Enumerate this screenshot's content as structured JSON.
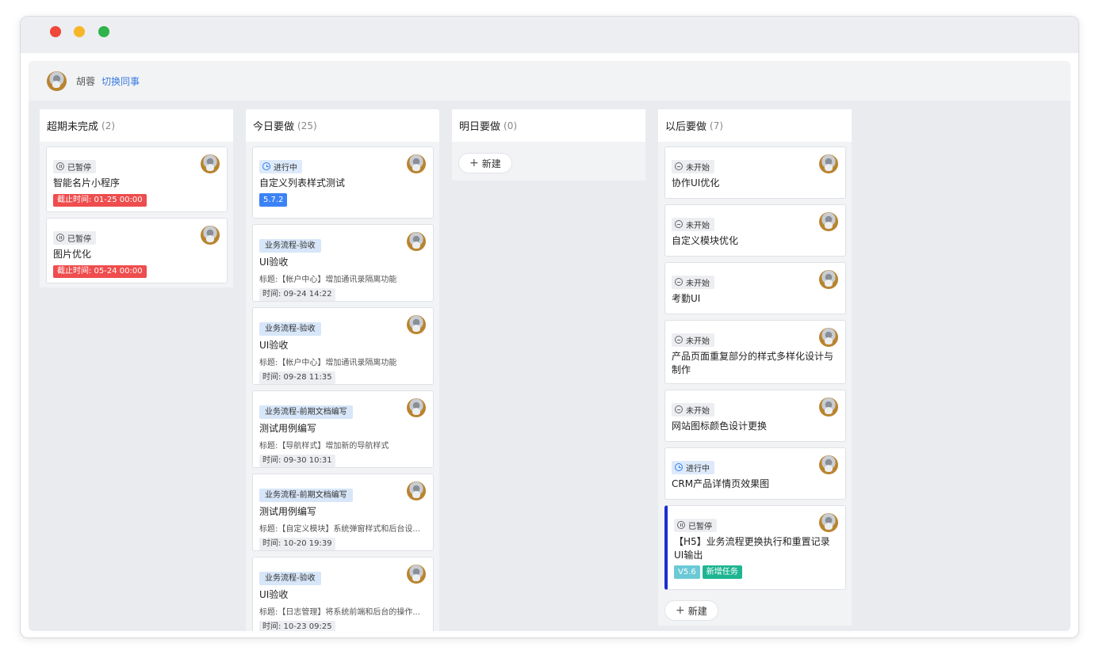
{
  "user": {
    "name": "胡蓉",
    "switch_label": "切换同事"
  },
  "columns": [
    {
      "title": "超期未完成",
      "count": "(2)",
      "cards": [
        {
          "status": "已暂停",
          "title": "智能名片小程序",
          "deadline": "截止时间: 01-25 00:00"
        },
        {
          "status": "已暂停",
          "title": "图片优化",
          "deadline": "截止时间: 05-24 00:00"
        }
      ]
    },
    {
      "title": "今日要做",
      "count": "(25)",
      "cards": [
        {
          "status": "进行中",
          "title": "自定义列表样式测试",
          "version": "5.7.2"
        },
        {
          "tag": "业务流程-验收",
          "title": "UI验收",
          "sub": "标题:【帐户中心】增加通讯录隔离功能",
          "time": "时间: 09-24 14:22"
        },
        {
          "tag": "业务流程-验收",
          "title": "UI验收",
          "sub": "标题:【帐户中心】增加通讯录隔离功能",
          "time": "时间: 09-28 11:35"
        },
        {
          "tag": "业务流程-前期文档编写",
          "title": "测试用例编写",
          "sub": "标题:【导航样式】增加新的导航样式",
          "time": "时间: 09-30 10:31"
        },
        {
          "tag": "业务流程-前期文档编写",
          "title": "测试用例编写",
          "sub": "标题:【自定义模块】系统弹窗样式和后台设...",
          "time": "时间: 10-20 19:39"
        },
        {
          "tag": "业务流程-验收",
          "title": "UI验收",
          "sub": "标题:【日志管理】将系统前端和后台的操作...",
          "time": "时间: 10-23 09:25"
        }
      ]
    },
    {
      "title": "明日要做",
      "count": "(0)",
      "new_label": "新建"
    },
    {
      "title": "以后要做",
      "count": "(7)",
      "cards": [
        {
          "status": "未开始",
          "title": "协作UI优化"
        },
        {
          "status": "未开始",
          "title": "自定义模块优化"
        },
        {
          "status": "未开始",
          "title": "考勤UI"
        },
        {
          "status": "未开始",
          "title": "产品页面重复部分的样式多样化设计与制作"
        },
        {
          "status": "未开始",
          "title": "网站图标颜色设计更换"
        },
        {
          "status": "进行中",
          "title": "CRM产品详情页效果图"
        },
        {
          "status": "已暂停",
          "title": "【H5】业务流程更换执行和重置记录 UI输出",
          "version": "V5.6",
          "extra_tag": "新增任务"
        }
      ],
      "new_label": "新建"
    }
  ],
  "colors": {
    "accent": "#3a7be0",
    "deadline": "#ef4d4d",
    "version_blue": "#3b82f6",
    "new_task": "#1fb592"
  }
}
